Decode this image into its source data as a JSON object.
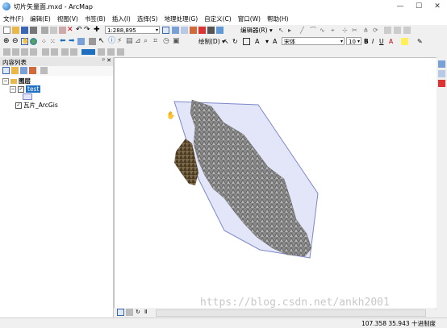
{
  "window": {
    "title": "切片矢量面.mxd - ArcMap",
    "minimize": "—",
    "maximize": "☐",
    "close": "✕"
  },
  "menubar": {
    "items": [
      "文件(F)",
      "编辑(E)",
      "视图(V)",
      "书签(B)",
      "插入(I)",
      "选择(S)",
      "地理处理(G)",
      "自定义(C)",
      "窗口(W)",
      "帮助(H)"
    ]
  },
  "toolbar": {
    "scale": "1:288,895",
    "editor_label": "编辑器(R) ▾",
    "draw_label": "绘制(D) ▾",
    "font_name": "宋体",
    "font_size": "10",
    "bold": "B",
    "italic": "I",
    "underline": "U",
    "text_a": "A"
  },
  "toc": {
    "title": "内容列表",
    "layers_group": "图层",
    "layer_test": "test",
    "layer_tiles": "瓦片_ArcGis"
  },
  "status": {
    "coordinates": "107.358  35.943 十进制度"
  },
  "map": {
    "watermark": "https://blog.csdn.net/ankh2001",
    "polygon_fill": "#e3e6f9",
    "polygon_stroke": "#7e88c8"
  },
  "icons": {
    "app": "arcmap-globe-icon",
    "hand": "pan-hand-icon"
  }
}
